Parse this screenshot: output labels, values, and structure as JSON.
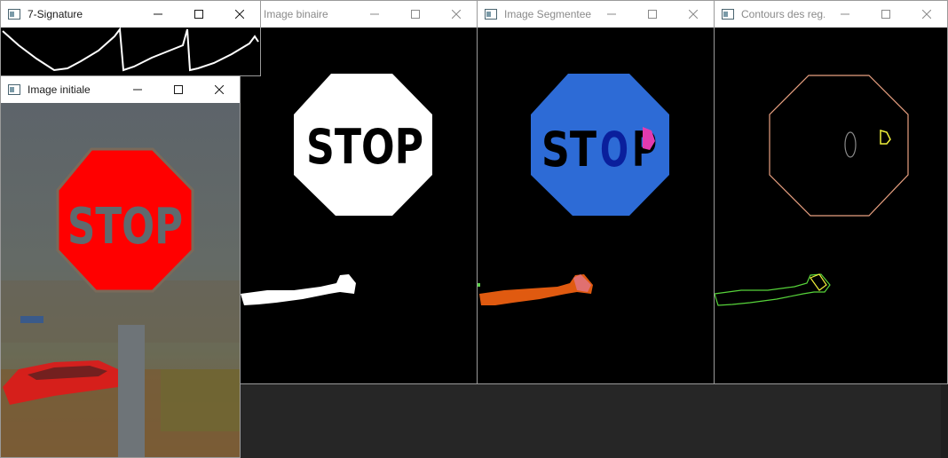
{
  "desktop": {
    "background": "#262626"
  },
  "windows": [
    {
      "id": "signature",
      "title": "7-Signature",
      "active": true
    },
    {
      "id": "initiale",
      "title": "Image initiale",
      "active": true
    },
    {
      "id": "binaire",
      "title": "Image binaire",
      "active": false
    },
    {
      "id": "segmentee",
      "title": "Image Segmentee",
      "active": false
    },
    {
      "id": "contours",
      "title": "Contours des reg...",
      "active": false
    }
  ],
  "controls": {
    "minimize": "minimize-icon",
    "maximize": "maximize-icon",
    "close": "close-icon"
  },
  "images": {
    "sign_text": "STOP",
    "segment_text_part1": "ST",
    "segment_text_part2": "O",
    "segment_text_part3": "P",
    "initial_sign_color": "#ff0000",
    "initial_text_color": "#5f6a6e",
    "segment_sign_color": "#2d6bd6",
    "segment_o_color": "#0a1f9c",
    "segment_p_color": "#e23bb0",
    "segment_car_color": "#e05a10",
    "contour_sign_color": "#e8a080",
    "contour_car_color": "#57d43a",
    "contour_p_color": "#f0f03a"
  }
}
